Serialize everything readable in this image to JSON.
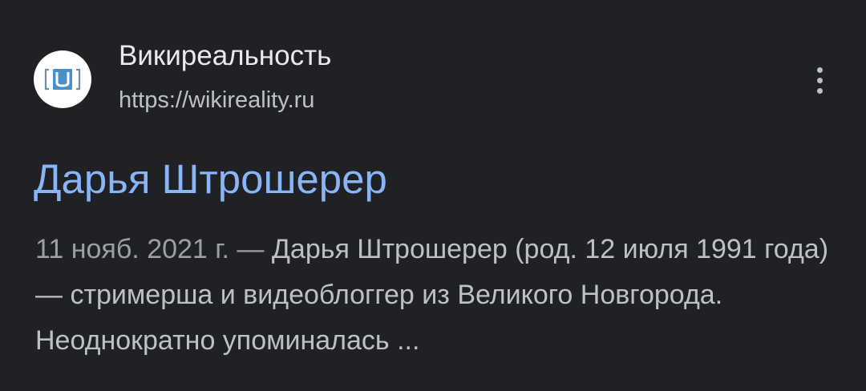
{
  "result": {
    "site_name": "Викиреальность",
    "site_url": "https://wikireality.ru",
    "favicon_icon": "wikireality-logo-icon",
    "menu_icon": "more-vert-icon",
    "title": "Дарья Штрошерер",
    "snippet_date": "11 нояб. 2021 г.",
    "snippet_separator": " — ",
    "snippet_text": "Дарья Штрошерер (род. 12 июля 1991 года) — стримерша и видеоблоггер из Великого Новгорода. Неоднократно упоминалась ..."
  },
  "colors": {
    "background": "#202124",
    "title_link": "#8ab4f8",
    "site_name": "#e8eaed",
    "secondary_text": "#bdc1c6",
    "favicon_blue": "#4a90c8"
  }
}
